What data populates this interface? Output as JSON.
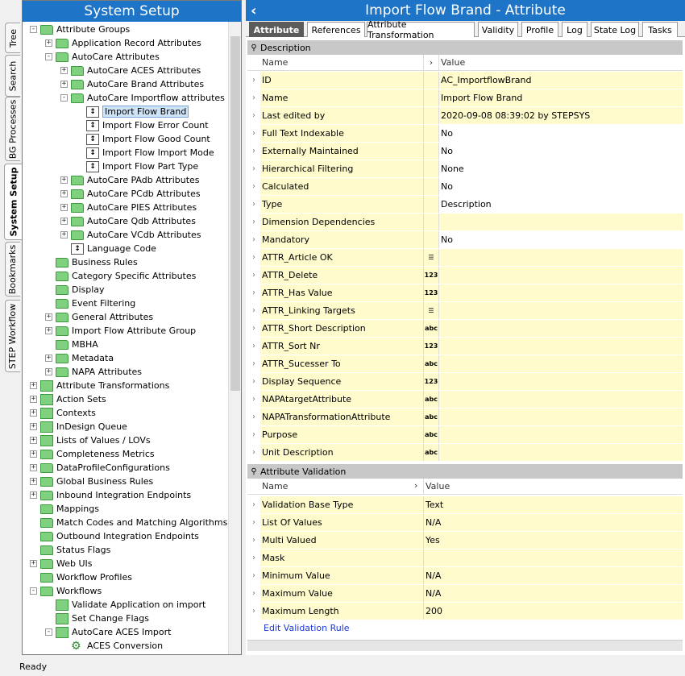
{
  "vertical_tabs": [
    {
      "label": "Tree",
      "active": false
    },
    {
      "label": "Search",
      "active": false
    },
    {
      "label": "BG Processes",
      "active": false
    },
    {
      "label": "System Setup",
      "active": true
    },
    {
      "label": "Bookmarks",
      "active": false
    },
    {
      "label": "STEP Workflow",
      "active": false
    }
  ],
  "left_panel": {
    "title": "System Setup",
    "tree": [
      {
        "label": "Attribute Groups",
        "depth": 0,
        "exp": "-",
        "icon": "folder-icon"
      },
      {
        "label": "Application Record Attributes",
        "depth": 1,
        "exp": "+",
        "icon": "folder-icon"
      },
      {
        "label": "AutoCare Attributes",
        "depth": 1,
        "exp": "-",
        "icon": "folder-icon"
      },
      {
        "label": "AutoCare ACES Attributes",
        "depth": 2,
        "exp": "+",
        "icon": "folder-icon"
      },
      {
        "label": "AutoCare Brand Attributes",
        "depth": 2,
        "exp": "+",
        "icon": "folder-icon"
      },
      {
        "label": "AutoCare Importflow attributes",
        "depth": 2,
        "exp": "-",
        "icon": "folder-icon"
      },
      {
        "label": "Import Flow Brand",
        "depth": 3,
        "exp": "",
        "icon": "attribute-icon",
        "selected": true
      },
      {
        "label": "Import Flow Error Count",
        "depth": 3,
        "exp": "",
        "icon": "attribute-icon"
      },
      {
        "label": "Import Flow Good Count",
        "depth": 3,
        "exp": "",
        "icon": "attribute-icon"
      },
      {
        "label": "Import Flow Import Mode",
        "depth": 3,
        "exp": "",
        "icon": "attribute-icon"
      },
      {
        "label": "Import Flow Part Type",
        "depth": 3,
        "exp": "",
        "icon": "attribute-icon"
      },
      {
        "label": "AutoCare PAdb Attributes",
        "depth": 2,
        "exp": "+",
        "icon": "folder-icon"
      },
      {
        "label": "AutoCare PCdb Attributes",
        "depth": 2,
        "exp": "+",
        "icon": "folder-icon"
      },
      {
        "label": "AutoCare PIES Attributes",
        "depth": 2,
        "exp": "+",
        "icon": "folder-icon"
      },
      {
        "label": "AutoCare Qdb Attributes",
        "depth": 2,
        "exp": "+",
        "icon": "folder-icon"
      },
      {
        "label": "AutoCare VCdb Attributes",
        "depth": 2,
        "exp": "+",
        "icon": "folder-icon"
      },
      {
        "label": "Language Code",
        "depth": 2,
        "exp": "",
        "icon": "attribute-icon"
      },
      {
        "label": "Business Rules",
        "depth": 1,
        "exp": "",
        "icon": "folder-icon"
      },
      {
        "label": "Category Specific Attributes",
        "depth": 1,
        "exp": "",
        "icon": "folder-icon"
      },
      {
        "label": "Display",
        "depth": 1,
        "exp": "",
        "icon": "folder-icon"
      },
      {
        "label": "Event Filtering",
        "depth": 1,
        "exp": "",
        "icon": "folder-icon"
      },
      {
        "label": "General Attributes",
        "depth": 1,
        "exp": "+",
        "icon": "folder-icon"
      },
      {
        "label": "Import Flow Attribute Group",
        "depth": 1,
        "exp": "+",
        "icon": "folder-icon"
      },
      {
        "label": "MBHA",
        "depth": 1,
        "exp": "",
        "icon": "folder-icon"
      },
      {
        "label": "Metadata",
        "depth": 1,
        "exp": "+",
        "icon": "folder-icon"
      },
      {
        "label": "NAPA Attributes",
        "depth": 1,
        "exp": "+",
        "icon": "folder-icon"
      },
      {
        "label": "Attribute Transformations",
        "depth": 0,
        "exp": "+",
        "icon": "transform-icon"
      },
      {
        "label": "Action Sets",
        "depth": 0,
        "exp": "+",
        "icon": "actionset-icon"
      },
      {
        "label": "Contexts",
        "depth": 0,
        "exp": "+",
        "icon": "context-icon"
      },
      {
        "label": "InDesign Queue",
        "depth": 0,
        "exp": "+",
        "icon": "indesign-icon"
      },
      {
        "label": "Lists of Values / LOVs",
        "depth": 0,
        "exp": "+",
        "icon": "lov-icon"
      },
      {
        "label": "Completeness Metrics",
        "depth": 0,
        "exp": "+",
        "icon": "folder-icon"
      },
      {
        "label": "DataProfileConfigurations",
        "depth": 0,
        "exp": "+",
        "icon": "folder-icon"
      },
      {
        "label": "Global Business Rules",
        "depth": 0,
        "exp": "+",
        "icon": "folder-icon"
      },
      {
        "label": "Inbound Integration Endpoints",
        "depth": 0,
        "exp": "+",
        "icon": "folder-icon"
      },
      {
        "label": "Mappings",
        "depth": 0,
        "exp": "",
        "icon": "folder-icon"
      },
      {
        "label": "Match Codes and Matching Algorithms",
        "depth": 0,
        "exp": "",
        "icon": "folder-icon"
      },
      {
        "label": "Outbound Integration Endpoints",
        "depth": 0,
        "exp": "",
        "icon": "folder-icon"
      },
      {
        "label": "Status Flags",
        "depth": 0,
        "exp": "",
        "icon": "folder-icon"
      },
      {
        "label": "Web UIs",
        "depth": 0,
        "exp": "+",
        "icon": "folder-icon"
      },
      {
        "label": "Workflow Profiles",
        "depth": 0,
        "exp": "",
        "icon": "folder-icon"
      },
      {
        "label": "Workflows",
        "depth": 0,
        "exp": "-",
        "icon": "folder-icon"
      },
      {
        "label": "Validate Application on import",
        "depth": 1,
        "exp": "",
        "icon": "workflow-icon"
      },
      {
        "label": "Set Change Flags",
        "depth": 1,
        "exp": "",
        "icon": "workflow-icon"
      },
      {
        "label": "AutoCare ACES Import",
        "depth": 1,
        "exp": "-",
        "icon": "workflow-icon"
      },
      {
        "label": "ACES Conversion",
        "depth": 2,
        "exp": "",
        "icon": "gear-icon"
      }
    ]
  },
  "right_panel": {
    "title": "Import Flow Brand - Attribute",
    "back_icon": "chevron-left-icon",
    "tabs": [
      {
        "label": "Attribute",
        "active": true
      },
      {
        "label": "References",
        "active": false
      },
      {
        "label": "Attribute Transformation",
        "active": false
      },
      {
        "label": "Validity",
        "active": false
      },
      {
        "label": "Profile",
        "active": false
      },
      {
        "label": "Log",
        "active": false
      },
      {
        "label": "State Log",
        "active": false
      },
      {
        "label": "Tasks",
        "active": false
      }
    ],
    "description": {
      "header": "Description",
      "col_name": "Name",
      "col_value": "Value",
      "rows": [
        {
          "name": "ID",
          "icon": "",
          "value": "AC_ImportflowBrand"
        },
        {
          "name": "Name",
          "icon": "",
          "value": "Import Flow Brand"
        },
        {
          "name": "Last edited by",
          "icon": "",
          "value": "2020-09-08 08:39:02 by STEPSYS"
        },
        {
          "name": "Full Text Indexable",
          "icon": "",
          "value": "No"
        },
        {
          "name": "Externally Maintained",
          "icon": "",
          "value": "No"
        },
        {
          "name": "Hierarchical Filtering",
          "icon": "",
          "value": "None"
        },
        {
          "name": "Calculated",
          "icon": "",
          "value": "No"
        },
        {
          "name": "Type",
          "icon": "",
          "value": "Description"
        },
        {
          "name": "Dimension Dependencies",
          "icon": "",
          "value": ""
        },
        {
          "name": "Mandatory",
          "icon": "",
          "value": "No"
        },
        {
          "name": "ATTR_Article OK",
          "icon": "list",
          "value": ""
        },
        {
          "name": "ATTR_Delete",
          "icon": "123",
          "value": ""
        },
        {
          "name": "ATTR_Has Value",
          "icon": "123",
          "value": ""
        },
        {
          "name": "ATTR_Linking Targets",
          "icon": "list",
          "value": ""
        },
        {
          "name": "ATTR_Short Description",
          "icon": "abc",
          "value": ""
        },
        {
          "name": "ATTR_Sort Nr",
          "icon": "123",
          "value": ""
        },
        {
          "name": "ATTR_Sucesser To",
          "icon": "abc",
          "value": ""
        },
        {
          "name": "Display Sequence",
          "icon": "123",
          "value": ""
        },
        {
          "name": "NAPAtargetAttribute",
          "icon": "abc",
          "value": ""
        },
        {
          "name": "NAPATransformationAttribute",
          "icon": "abc",
          "value": ""
        },
        {
          "name": "Purpose",
          "icon": "abc",
          "value": ""
        },
        {
          "name": "Unit Description",
          "icon": "abc",
          "value": ""
        }
      ]
    },
    "validation": {
      "header": "Attribute Validation",
      "col_name": "Name",
      "col_value": "Value",
      "rows": [
        {
          "name": "Validation Base Type",
          "value": "Text"
        },
        {
          "name": "List Of Values",
          "value": "N/A"
        },
        {
          "name": "Multi Valued",
          "value": "Yes"
        },
        {
          "name": "Mask",
          "value": ""
        },
        {
          "name": "Minimum Value",
          "value": "N/A"
        },
        {
          "name": "Maximum Value",
          "value": "N/A"
        },
        {
          "name": "Maximum Length",
          "value": "200"
        }
      ],
      "link": "Edit Validation Rule"
    }
  },
  "status": "Ready"
}
